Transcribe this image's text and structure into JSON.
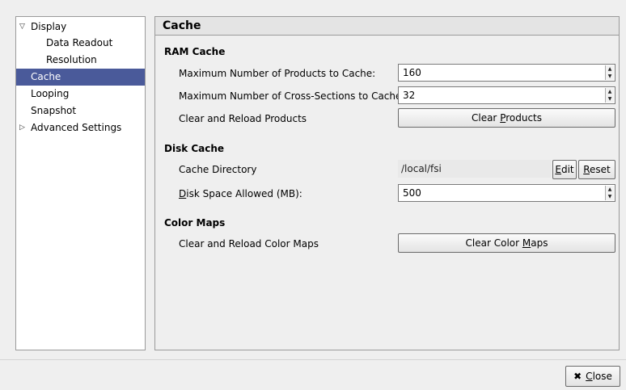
{
  "tree": {
    "items": [
      {
        "label": "Display",
        "expander": "▽"
      },
      {
        "label": "Data Readout"
      },
      {
        "label": "Resolution"
      },
      {
        "label": "Cache"
      },
      {
        "label": "Looping"
      },
      {
        "label": "Snapshot"
      },
      {
        "label": "Advanced Settings",
        "expander": "▷"
      }
    ],
    "selected_index": 3
  },
  "panel": {
    "title": "Cache",
    "ram": {
      "heading": "RAM Cache",
      "max_products_label": "Maximum Number of Products to Cache:",
      "max_products_value": "160",
      "max_cross_label": "Maximum Number of Cross-Sections to Cache:",
      "max_cross_value": "32",
      "clear_products_label": "Clear and Reload Products",
      "clear_products_button_pre": "Clear ",
      "clear_products_button_u": "P",
      "clear_products_button_post": "roducts"
    },
    "disk": {
      "heading": "Disk Cache",
      "dir_label": "Cache Directory",
      "dir_value": "/local/fsi",
      "edit_u": "E",
      "edit_post": "dit",
      "reset_u": "R",
      "reset_post": "eset",
      "space_label_u": "D",
      "space_label_post": "isk Space Allowed (MB):",
      "space_value": "500"
    },
    "colormaps": {
      "heading": "Color Maps",
      "clear_label": "Clear and Reload Color Maps",
      "clear_button_pre": "Clear Color ",
      "clear_button_u": "M",
      "clear_button_post": "aps"
    }
  },
  "footer": {
    "close_icon": "✖",
    "close_u": "C",
    "close_post": "lose"
  }
}
